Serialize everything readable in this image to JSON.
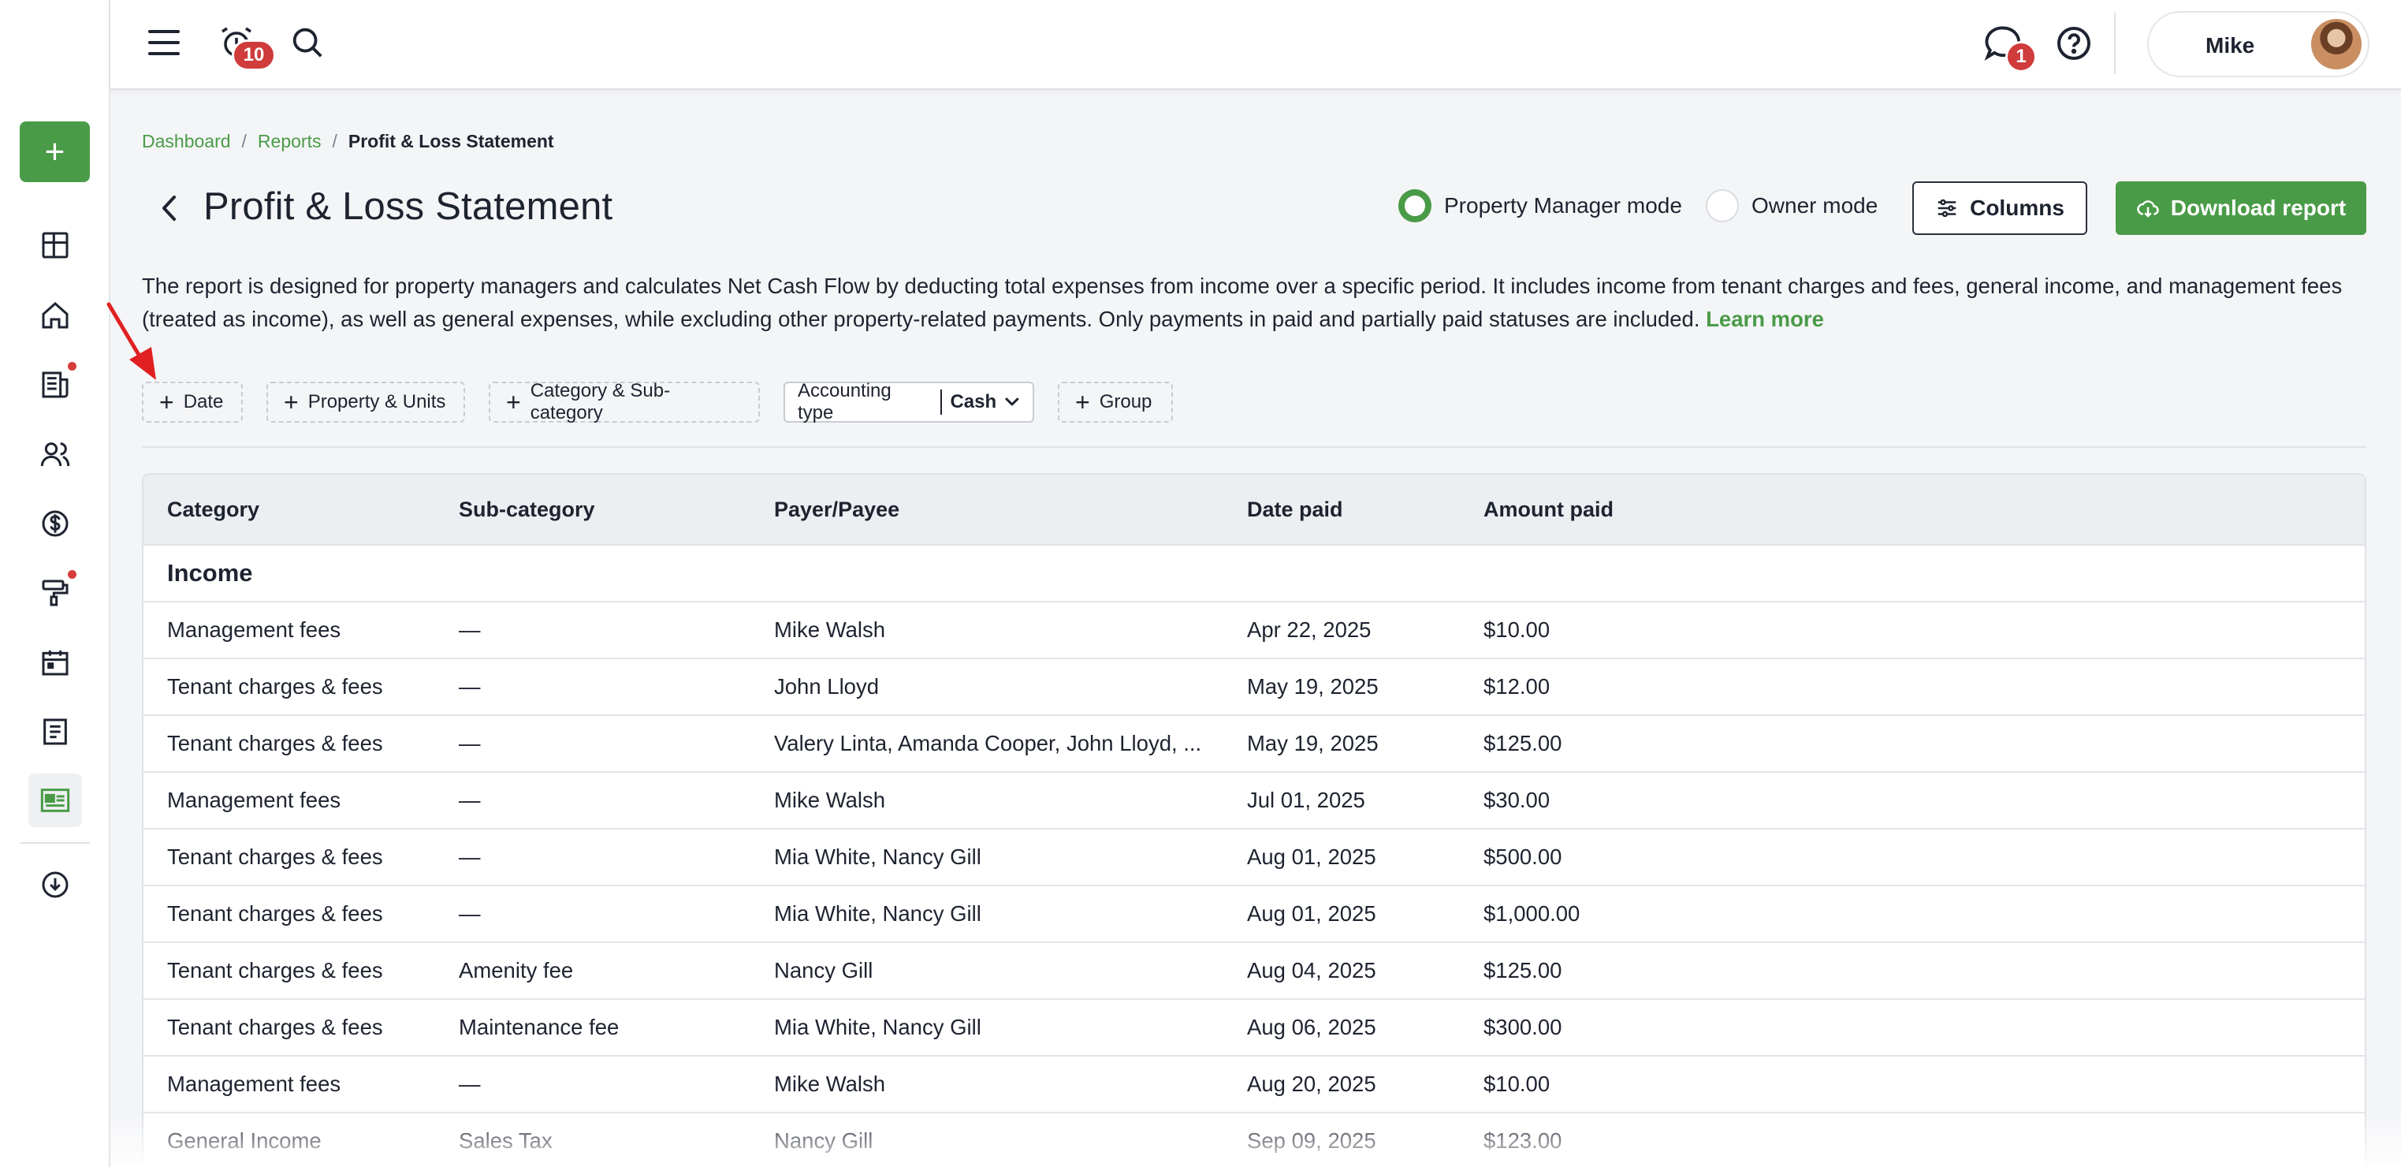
{
  "topbar": {
    "notifications_count": "10",
    "messages_count": "1",
    "user_name": "Mike"
  },
  "sidebar": {
    "add_label": "+",
    "items": [
      "dashboard-icon",
      "home-icon",
      "news-icon",
      "people-icon",
      "dollar-icon",
      "paint-roller-icon",
      "calendar-icon",
      "document-icon",
      "report-icon",
      "cloud-download-icon"
    ]
  },
  "breadcrumb": {
    "items": [
      "Dashboard",
      "Reports"
    ],
    "separator": "/",
    "current": "Profit & Loss Statement"
  },
  "page": {
    "title": "Profit & Loss Statement",
    "mode_property_manager": "Property Manager mode",
    "mode_owner": "Owner mode",
    "columns_label": "Columns",
    "download_label": "Download report",
    "description": "The report is designed for property managers and calculates Net Cash Flow by deducting total expenses from income over a specific period. It includes income from tenant charges and fees, general income, and management fees (treated as income), as well as general expenses, while excluding other property-related payments. Only payments in paid and partially paid statuses are included.",
    "learn_more": "Learn more"
  },
  "filters": {
    "date": "Date",
    "property_units": "Property & Units",
    "category": "Category & Sub-category",
    "accounting_type_label": "Accounting type",
    "accounting_type_value": "Cash",
    "group": "Group"
  },
  "table": {
    "headers": [
      "Category",
      "Sub-category",
      "Payer/Payee",
      "Date paid",
      "Amount paid"
    ],
    "group_label": "Income",
    "rows": [
      [
        "Management fees",
        "—",
        "Mike Walsh",
        "Apr 22, 2025",
        "$10.00"
      ],
      [
        "Tenant charges & fees",
        "—",
        "John Lloyd",
        "May 19, 2025",
        "$12.00"
      ],
      [
        "Tenant charges & fees",
        "—",
        "Valery Linta, Amanda Cooper, John Lloyd, ...",
        "May 19, 2025",
        "$125.00"
      ],
      [
        "Management fees",
        "—",
        "Mike Walsh",
        "Jul 01, 2025",
        "$30.00"
      ],
      [
        "Tenant charges & fees",
        "—",
        "Mia White, Nancy Gill",
        "Aug 01, 2025",
        "$500.00"
      ],
      [
        "Tenant charges & fees",
        "—",
        "Mia White, Nancy Gill",
        "Aug 01, 2025",
        "$1,000.00"
      ],
      [
        "Tenant charges & fees",
        "Amenity fee",
        "Nancy Gill",
        "Aug 04, 2025",
        "$125.00"
      ],
      [
        "Tenant charges & fees",
        "Maintenance fee",
        "Mia White, Nancy Gill",
        "Aug 06, 2025",
        "$300.00"
      ],
      [
        "Management fees",
        "—",
        "Mike Walsh",
        "Aug 20, 2025",
        "$10.00"
      ],
      [
        "General Income",
        "Sales Tax",
        "Nancy Gill",
        "Sep 09, 2025",
        "$123.00"
      ]
    ]
  },
  "colors": {
    "accent": "#4a9b47",
    "badge": "#d03b3b",
    "annotation_arrow": "#e02020"
  }
}
